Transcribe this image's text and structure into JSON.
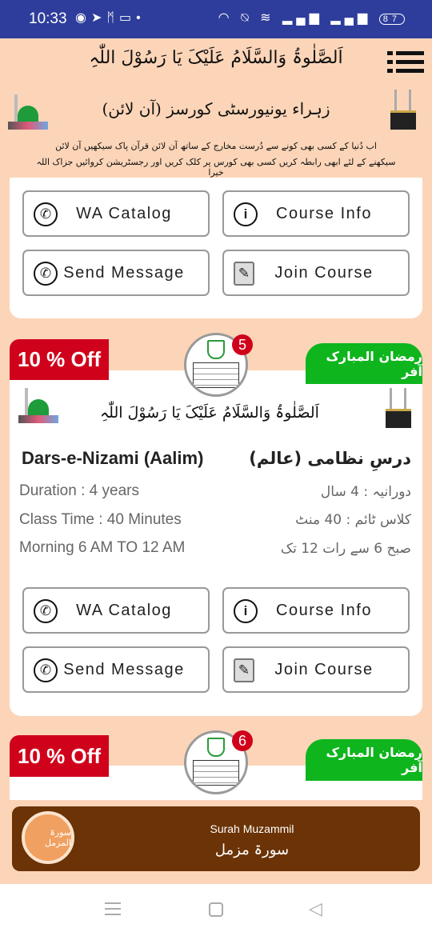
{
  "status_bar": {
    "time": "10:33",
    "left_icons": [
      "telegram-icon",
      "send-icon",
      "gmail-icon",
      "laptop-icon",
      "dot-icon"
    ],
    "right_icons": [
      "headset-icon",
      "mute-icon",
      "wifi-icon",
      "signal-icon",
      "signal-icon"
    ],
    "battery": "87"
  },
  "header": {
    "salawat": "اَلصَّلٰوۃُ وَالسَّلَامُ عَلَیْکَ یَا رَسُوْلَ اللّٰہِ",
    "title": "زہراء یونیورسٹی کورسز (آن لائن)",
    "intro_line1": "اب دُنیا کے کسی بھی کونے سے دُرست مخارج کے ساتھ آن لائن قرآن پاک سیکھیں آن لائن",
    "intro_line2": "سیکھنے کے لئے ابھی رابطہ کریں کسی بھی کورس پر کلک کریں اور رجسٹریشن کروائیں جزاک اللہ خیرا"
  },
  "buttons": {
    "wa_catalog": "WA Catalog",
    "course_info": "Course Info",
    "send_message": "Send Message",
    "join_course": "Join Course"
  },
  "courses": [
    {
      "discount": "10 % Off",
      "offer": "رمضان المبارک آفر",
      "number": "5",
      "salawat": "اَلصَّلٰوۃُ وَالسَّلَامُ عَلَیْکَ یَا رَسُوْلَ اللّٰہِ",
      "title_en": "Dars-e-Nizami (Aalim)",
      "title_ur": "درسِ نظامی (عالم)",
      "duration_en": "Duration : 4 years",
      "duration_ur": "دورانیہ : 4 سال",
      "class_time_en": "Class Time : 40 Minutes",
      "class_time_ur": "کلاس ٹائم : 40 منٹ",
      "timing_en": "Morning 6 AM TO 12 AM",
      "timing_ur": "صبح 6 سے رات 12 تک"
    },
    {
      "discount": "10 % Off",
      "offer": "رمضان المبارک آفر",
      "number": "6"
    }
  ],
  "banner": {
    "title_en": "Surah Muzammil",
    "title_ur": "سورۃ مزمل",
    "logo_text": "سورۃ المزمل"
  },
  "colors": {
    "status_bar": "#2e3d9b",
    "background": "#fcd5b8",
    "discount": "#d0021b",
    "offer": "#0fb51d",
    "banner": "#6b3306"
  }
}
